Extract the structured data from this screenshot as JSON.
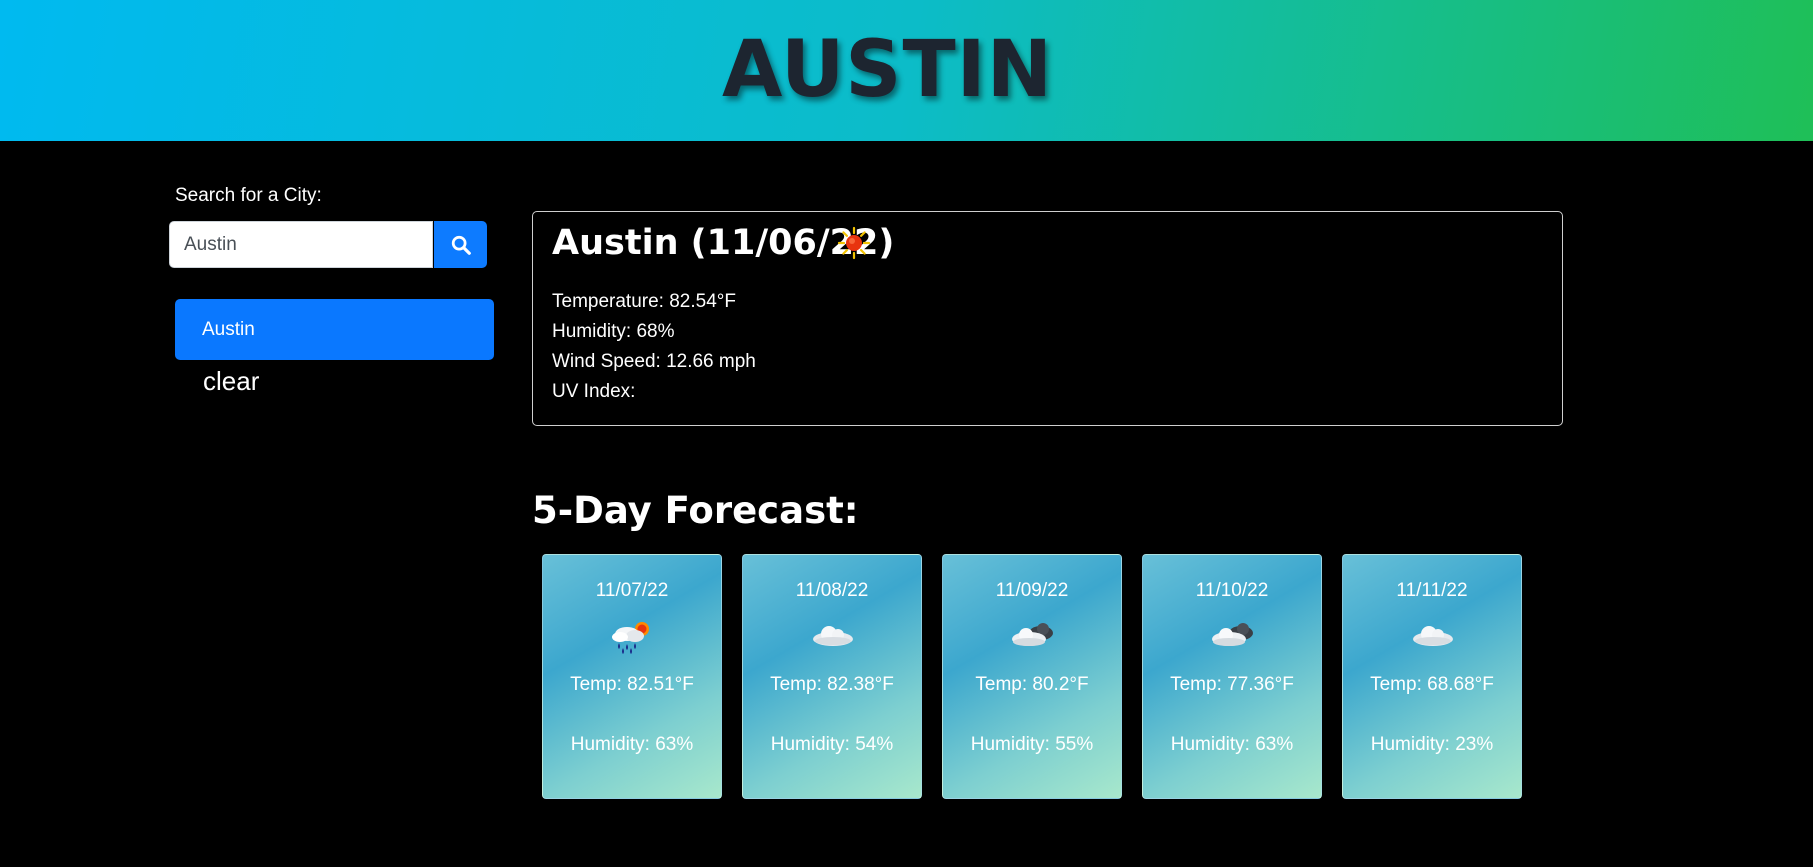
{
  "header": {
    "title": "AUSTIN"
  },
  "search": {
    "label": "Search for a City:",
    "value": "Austin",
    "placeholder": "",
    "button_icon": "search-icon"
  },
  "history": {
    "items": [
      {
        "label": "Austin"
      }
    ],
    "clear_label": "clear"
  },
  "current": {
    "title": "Austin (11/06/22)",
    "icon": "sun-icon",
    "temperature": "Temperature: 82.54°F",
    "humidity": "Humidity: 68%",
    "wind": "Wind Speed: 12.66 mph",
    "uv": "UV Index:"
  },
  "forecast": {
    "title": "5-Day Forecast:",
    "days": [
      {
        "date": "11/07/22",
        "icon": "rain-sun-icon",
        "temp": "Temp: 82.51°F",
        "humidity": "Humidity: 63%"
      },
      {
        "date": "11/08/22",
        "icon": "cloud-icon",
        "temp": "Temp: 82.38°F",
        "humidity": "Humidity: 54%"
      },
      {
        "date": "11/09/22",
        "icon": "dark-cloud-icon",
        "temp": "Temp: 80.2°F",
        "humidity": "Humidity: 55%"
      },
      {
        "date": "11/10/22",
        "icon": "dark-cloud-icon",
        "temp": "Temp: 77.36°F",
        "humidity": "Humidity: 63%"
      },
      {
        "date": "11/11/22",
        "icon": "cloud-icon",
        "temp": "Temp: 68.68°F",
        "humidity": "Humidity: 23%"
      }
    ]
  },
  "colors": {
    "header_gradient_start": "#00baf0",
    "header_gradient_end": "#1fbf57",
    "accent_blue": "#0a78ff",
    "background": "#000000"
  }
}
